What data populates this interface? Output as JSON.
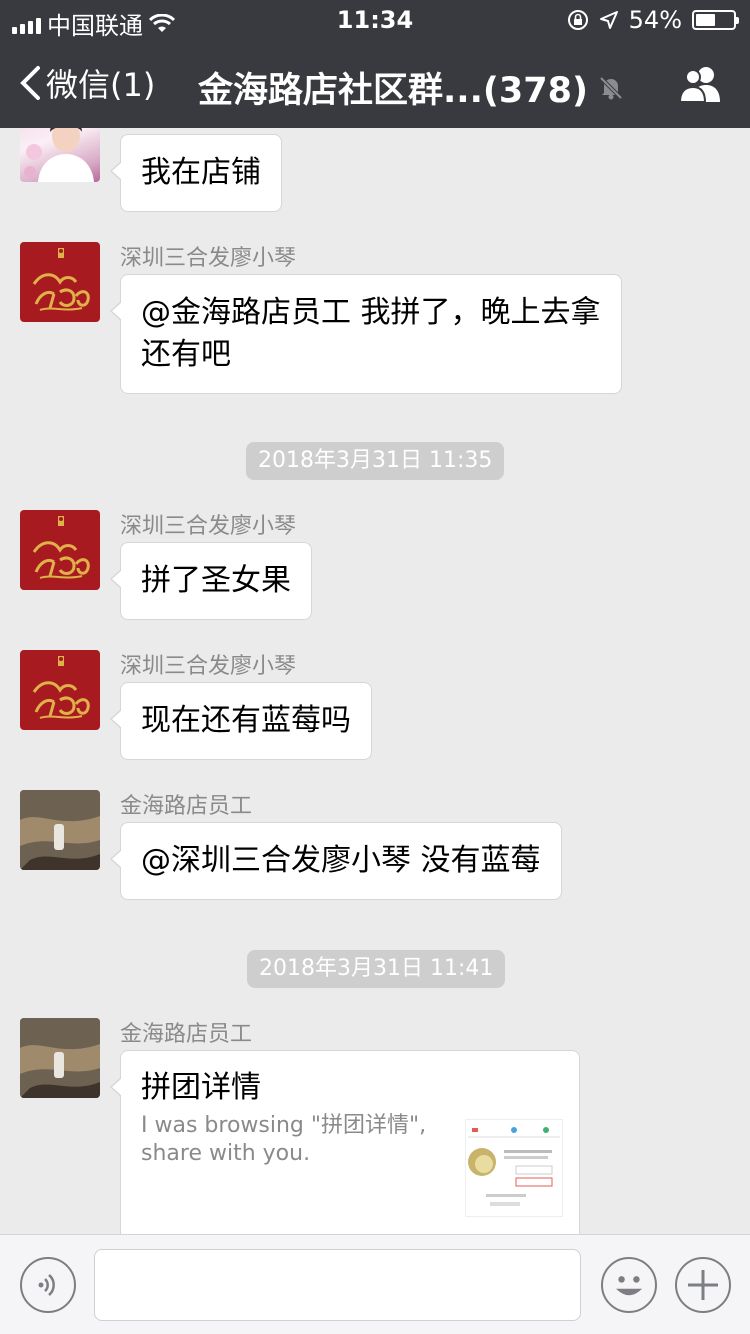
{
  "status_bar": {
    "carrier": "中国联通",
    "time": "11:34",
    "battery_percent_label": "54%",
    "battery_level": 0.54
  },
  "nav": {
    "back_label": "微信(1)",
    "title": "金海路店社区群...(378)"
  },
  "messages": [
    {
      "sender": "",
      "text": "我在店铺",
      "avatar": "photo-girl"
    },
    {
      "sender": "深圳三合发廖小琴",
      "text": "@金海路店员工 我拼了，晚上去拿还有吧",
      "avatar": "red-2018"
    },
    {
      "sender": "深圳三合发廖小琴",
      "text": "拼了圣女果",
      "avatar": "red-2018"
    },
    {
      "sender": "深圳三合发廖小琴",
      "text": "现在还有蓝莓吗",
      "avatar": "red-2018"
    },
    {
      "sender": "金海路店员工",
      "text": "@深圳三合发廖小琴 没有蓝莓",
      "avatar": "photo-hand"
    },
    {
      "sender": "金海路店员工",
      "card_title": "拼团详情",
      "card_desc": "I was browsing \"拼团详情\", share with you.",
      "avatar": "photo-hand"
    }
  ],
  "timestamps": [
    "2018年3月31日 11:35",
    "2018年3月31日 11:41"
  ],
  "input": {
    "value": "",
    "placeholder": ""
  },
  "colors": {
    "nav_bg": "#393a3f",
    "chat_bg": "#ebebeb",
    "bubble_bg": "#ffffff",
    "timestamp_bg": "#cecece",
    "avatar_red": "#a71a1f",
    "avatar_gold": "#e0b04a"
  },
  "icons": {
    "signal": "signal-bars-icon",
    "wifi": "wifi-icon",
    "rotation_lock": "rotation-lock-icon",
    "location": "location-arrow-icon",
    "battery": "battery-icon",
    "back": "chevron-left-icon",
    "mute": "bell-muted-icon",
    "members": "group-members-icon",
    "voice": "voice-icon",
    "emoji": "emoji-icon",
    "more": "plus-icon"
  }
}
